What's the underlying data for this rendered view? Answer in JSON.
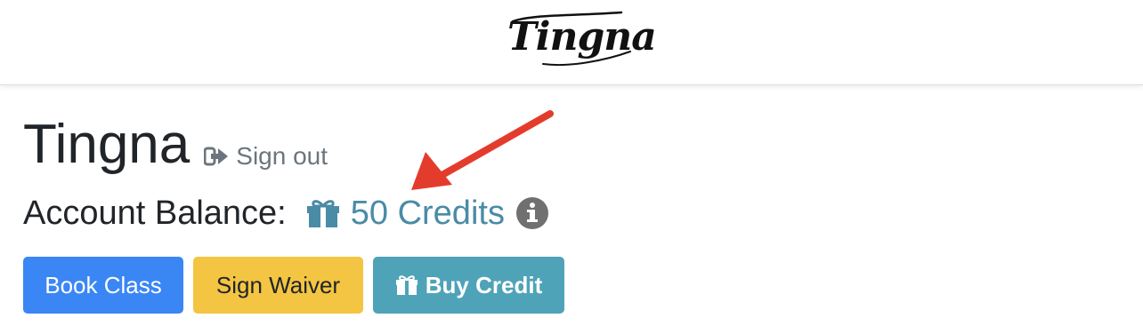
{
  "header": {
    "logo_text": "Tingna"
  },
  "profile": {
    "name": "Tingna",
    "sign_out_label": "Sign out"
  },
  "balance": {
    "label": "Account Balance:",
    "credits_text": "50 Credits",
    "credits_value": 50
  },
  "actions": {
    "book_class_label": "Book Class",
    "sign_waiver_label": "Sign Waiver",
    "buy_credit_label": "Buy Credit"
  },
  "icons": {
    "sign_out": "sign-out-icon",
    "credits": "gift-icon",
    "info": "info-circle-icon",
    "buy_credit": "gift-icon"
  },
  "colors": {
    "primary": "#3a86f5",
    "warning": "#f4c542",
    "info": "#4fa3b8",
    "credits_text": "#4a8ba6",
    "annotation_arrow": "#e43c2c"
  }
}
